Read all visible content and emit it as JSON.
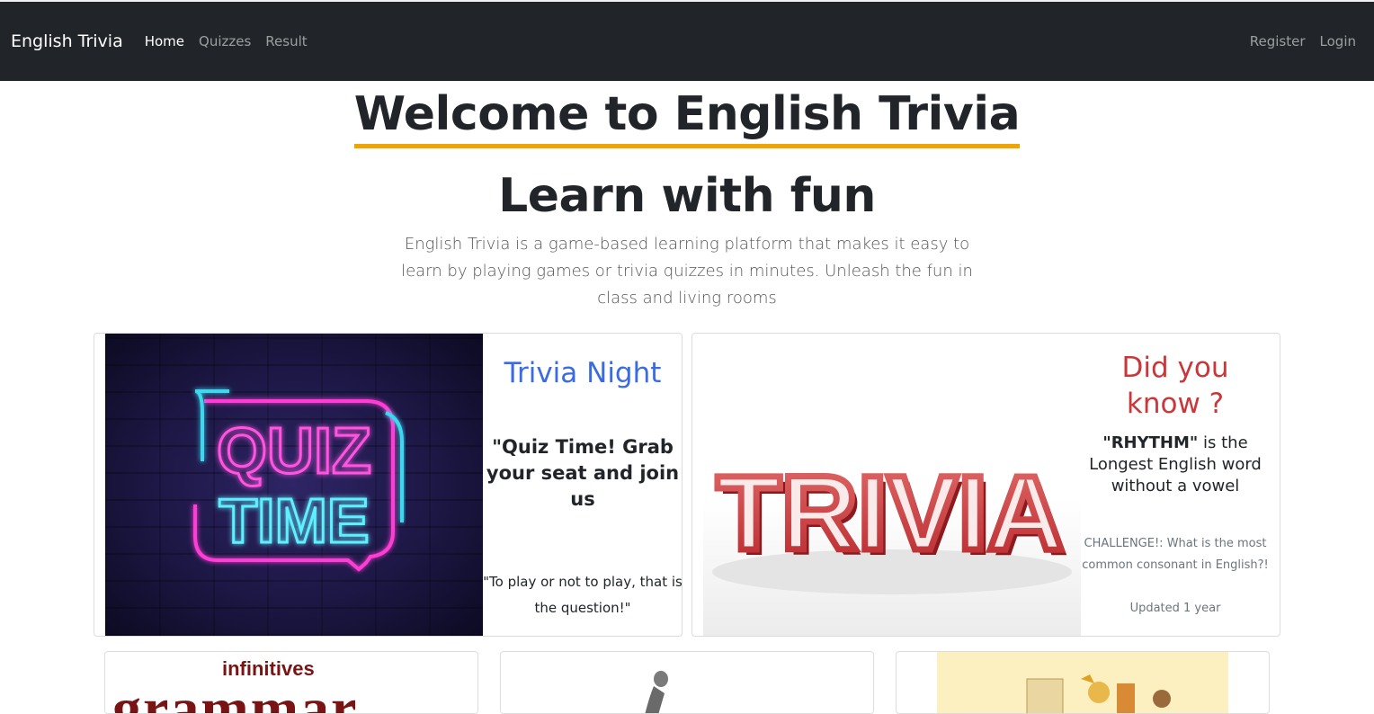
{
  "navbar": {
    "brand": "English Trivia",
    "links": [
      "Home",
      "Quizzes",
      "Result"
    ],
    "right_links": [
      "Register",
      "Login"
    ]
  },
  "hero": {
    "welcome": "Welcome to English Trivia",
    "learn": "Learn with fun",
    "lead": "English Trivia is a game-based learning platform that makes it easy to learn by playing games or trivia quizzes in minutes. Unleash the fun in class and living rooms"
  },
  "card1": {
    "image_text": [
      "QUIZ",
      "TIME"
    ],
    "title": "Trivia Night",
    "quote": "\"Quiz Time! Grab your seat and join us",
    "subquote": "\"To play or not to play, that is the question!\""
  },
  "card2": {
    "image_text": "TRIVIA",
    "title": "Did you know ?",
    "fact_word": "\"RHYTHM\"",
    "fact_rest": " is the Longest English word without a vowel",
    "challenge": "CHALLENGE!: What is the most common consonant in English?!",
    "updated": "Updated 1 year"
  },
  "bottom_cards": {
    "grammar_small": "infinitives",
    "grammar_big": "grammar"
  },
  "colors": {
    "navbar": "#212529",
    "underline": "#f0a400",
    "trivia_night": "#3a6be0",
    "did_you_know": "#c9373a"
  }
}
